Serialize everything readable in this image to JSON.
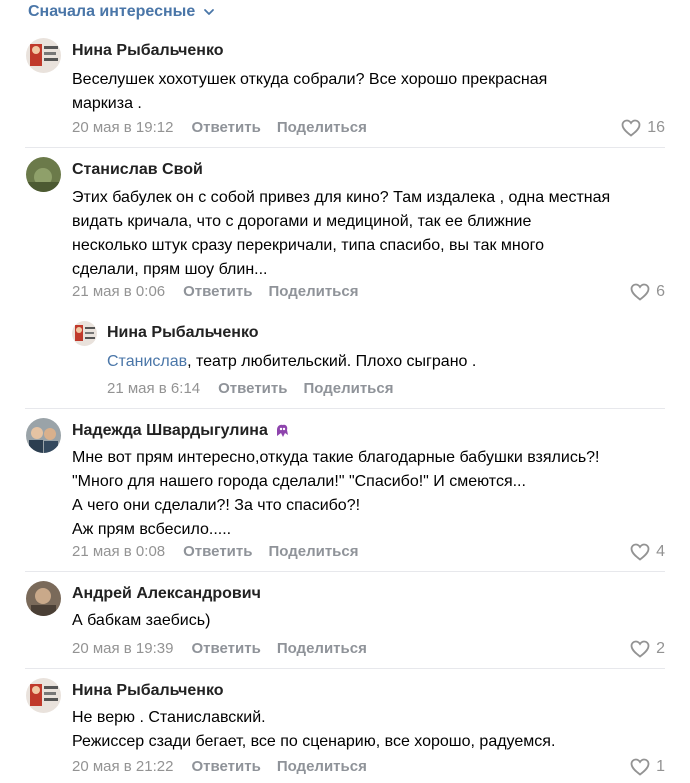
{
  "sort": {
    "label": "Сначала интересные"
  },
  "comments": [
    {
      "author": "Нина Рыбальченко",
      "text": "Веселушек хохотушек откуда собрали? Все хорошо прекрасная\nмаркиза .",
      "date": "20 мая в 19:12",
      "reply": "Ответить",
      "share": "Поделиться",
      "likes": "16"
    },
    {
      "author": "Станислав Свой",
      "text": "Этих бабулек он с собой привез для кино? Там издалека , одна местная\nвидать кричала, что с дорогами и медициной, так ее ближние\nнесколько штук сразу перекричали, типа спасибо, вы так много\nсделали, прям шоу блин...",
      "date": "21 мая в 0:06",
      "reply": "Ответить",
      "share": "Поделиться",
      "likes": "6"
    },
    {
      "author": "Нина Рыбальченко",
      "mention": "Станислав",
      "text": ", театр любительский. Плохо сыграно .",
      "date": "21 мая в 6:14",
      "reply": "Ответить",
      "share": "Поделиться"
    },
    {
      "author": "Надежда Швардыгулина",
      "emoji": "purple-creature-emoji",
      "text": "Мне вот прям интересно,откуда такие благодарные бабушки взялись?!\n\"Много для нашего города сделали!\" \"Спасибо!\" И смеются...\nА чего они сделали?! За что спасибо?!\nАж прям всбесило.....",
      "date": "21 мая в 0:08",
      "reply": "Ответить",
      "share": "Поделиться",
      "likes": "4"
    },
    {
      "author": "Андрей Александрович",
      "text": "А бабкам заебись)",
      "date": "20 мая в 19:39",
      "reply": "Ответить",
      "share": "Поделиться",
      "likes": "2"
    },
    {
      "author": "Нина Рыбальченко",
      "text": "Не верю . Станиславский.\nРежиссер сзади бегает, все по сценарию, все хорошо, радуемся.",
      "date": "20 мая в 21:22",
      "reply": "Ответить",
      "share": "Поделиться",
      "likes": "1"
    }
  ],
  "colors": {
    "link": "#4a76a8",
    "meta": "#939393",
    "divider": "#e7e8ec",
    "author": "#222222"
  },
  "icons": [
    "chevron-down-icon",
    "heart-icon"
  ]
}
